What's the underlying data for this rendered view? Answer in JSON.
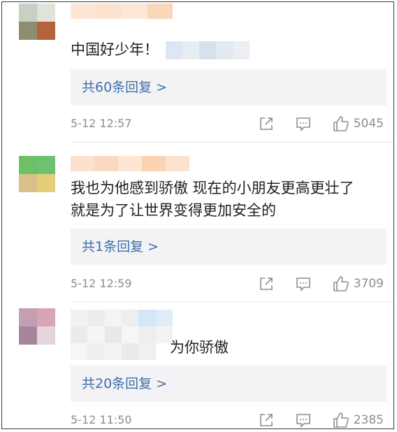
{
  "comments": [
    {
      "text": "中国好少年！",
      "text2": "",
      "replies_label": "共60条回复 >",
      "time": "5-12 12:57",
      "likes": "5045",
      "avatar_colors": [
        "#c8cfc3",
        "#dfe3da",
        "#8f8d6f",
        "#b5633a"
      ]
    },
    {
      "text": "我也为他感到骄傲 现在的小朋友更高更壮了",
      "text2": "就是为了让世界变得更加安全的",
      "replies_label": "共1条回复 >",
      "time": "5-12 12:59",
      "likes": "3709",
      "avatar_colors": [
        "#6fbf67",
        "#6ec171",
        "#d8c08a",
        "#e6cd7a"
      ]
    },
    {
      "text": "为你骄傲",
      "text2": "",
      "replies_label": "共20条回复 >",
      "time": "5-12 11:50",
      "likes": "2385",
      "avatar_colors": [
        "#c49fb3",
        "#d9a4b6",
        "#a5869b",
        "#e5d5dd"
      ]
    }
  ],
  "icons": {
    "share": "share-icon",
    "reply": "comment-icon",
    "like": "thumbs-up-icon"
  },
  "colors": {
    "link": "#3e6ea6",
    "meta": "#8d8d8d",
    "reply_bg": "#f3f3f5"
  }
}
